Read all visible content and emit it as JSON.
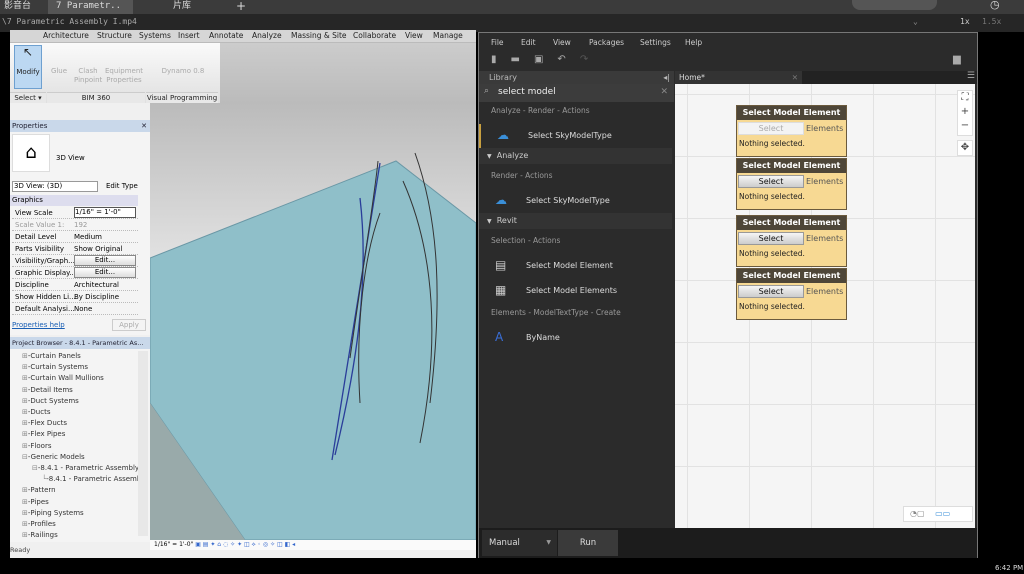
{
  "player": {
    "tabs": [
      "影音台",
      "7 Parametr..",
      "片库",
      "+"
    ],
    "tab_close": "×",
    "path": "\\7 Parametric Assembly I.mp4",
    "speeds": [
      "1x",
      "1.5x"
    ]
  },
  "revit": {
    "ribbon_tabs": [
      "Architecture",
      "Structure",
      "Systems",
      "Insert",
      "Annotate",
      "Analyze",
      "Massing & Site",
      "Collaborate",
      "View",
      "Manage"
    ],
    "buttons": [
      "Modify",
      "Glue",
      "Clash Pinpoint",
      "Equipment Properties",
      "Dynamo 0.8"
    ],
    "groups": [
      "Select ▾",
      "BIM 360",
      "Visual Programming"
    ],
    "properties": {
      "title": "Properties",
      "type": "3D View",
      "view_select": "3D View: (3D)",
      "edit_type": "Edit Type",
      "section": "Graphics",
      "rows": [
        [
          "View Scale",
          "1/16\" = 1'-0\""
        ],
        [
          "Scale Value    1:",
          "192"
        ],
        [
          "Detail Level",
          "Medium"
        ],
        [
          "Parts Visibility",
          "Show Original"
        ],
        [
          "Visibility/Graph...",
          "Edit..."
        ],
        [
          "Graphic Display...",
          "Edit..."
        ],
        [
          "Discipline",
          "Architectural"
        ],
        [
          "Show Hidden Li...",
          "By Discipline"
        ],
        [
          "Default Analysi...",
          "None"
        ]
      ],
      "help": "Properties help",
      "apply": "Apply"
    },
    "browser": {
      "title": "Project Browser - 8.4.1 - Parametric As...",
      "items": [
        "Curtain Panels",
        "Curtain Systems",
        "Curtain Wall Mullions",
        "Detail Items",
        "Duct Systems",
        "Ducts",
        "Flex Ducts",
        "Flex Pipes",
        "Floors",
        "Generic Models",
        "8.4.1 - Parametric Assembly",
        "8.4.1 - Parametric Assembl",
        "Pattern",
        "Pipes",
        "Piping Systems",
        "Profiles",
        "Railings"
      ]
    },
    "status_scale": "1/16\" = 1'-0\"",
    "status": "Ready"
  },
  "dynamo": {
    "menu": [
      "File",
      "Edit",
      "View",
      "Packages",
      "Settings",
      "Help"
    ],
    "library_title": "Library",
    "search": "select model",
    "library": [
      {
        "kind": "sub",
        "text": "Analyze - Render - Actions"
      },
      {
        "kind": "item",
        "text": "Select SkyModelType"
      },
      {
        "kind": "cat",
        "text": "Analyze"
      },
      {
        "kind": "sub",
        "text": "Render - Actions"
      },
      {
        "kind": "item",
        "text": "Select SkyModelType"
      },
      {
        "kind": "cat",
        "text": "Revit"
      },
      {
        "kind": "sub",
        "text": "Selection - Actions"
      },
      {
        "kind": "item",
        "text": "Select Model Element"
      },
      {
        "kind": "item",
        "text": "Select Model Elements"
      },
      {
        "kind": "sub",
        "text": "Elements - ModelTextType - Create"
      },
      {
        "kind": "item",
        "text": "ByName"
      }
    ],
    "tab": "Home*",
    "nodes": [
      {
        "title": "Select Model Element",
        "button": "Select",
        "port": "Elements",
        "status": "Nothing selected."
      },
      {
        "title": "Select Model Element",
        "button": "Select",
        "port": "Elements",
        "status": "Nothing selected."
      },
      {
        "title": "Select Model Element",
        "button": "Select",
        "port": "Elements",
        "status": "Nothing selected."
      },
      {
        "title": "Select Model Element",
        "button": "Select",
        "port": "Elements",
        "status": "Nothing selected."
      }
    ],
    "run_mode": "Manual",
    "run": "Run"
  },
  "taskbar": {
    "time": "6:42 PM"
  }
}
